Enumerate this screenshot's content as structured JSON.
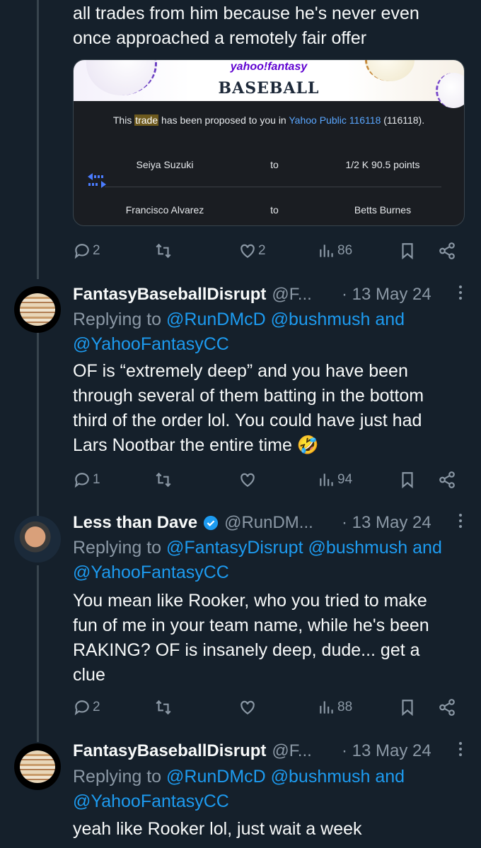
{
  "tweet0": {
    "text_tail": "all trades from him because he's never even\nonce approached a remotely fair offer",
    "attachment": {
      "brand": "yahoo!fantasy",
      "title": "BASEBALL",
      "notice_pre": "This ",
      "notice_highlight": "trade",
      "notice_mid": " has been proposed to you in ",
      "notice_link": "Yahoo Public 116118",
      "notice_post": " (116118).",
      "rows": [
        {
          "player": "Seiya Suzuki",
          "to": "to",
          "team": "1/2 K 90.5 points"
        },
        {
          "player": "Francisco Alvarez",
          "to": "to",
          "team": "Betts Burnes"
        }
      ]
    },
    "actions": {
      "replies": "2",
      "likes": "2",
      "views": "86"
    }
  },
  "tweet1": {
    "name": "FantasyBaseballDisrupt",
    "handle": "@F...",
    "date": "· 13 May 24",
    "replying_to": "Replying to",
    "mentions": "@RunDMcD @bushmush and",
    "mentions2": "@YahooFantasyCC",
    "text": "OF is “extremely deep” and you have been\nthrough several of them batting in the bottom\nthird of the order lol. You could have just had\nLars Nootbar the entire time 🤣",
    "actions": {
      "replies": "1",
      "likes": "",
      "views": "94"
    }
  },
  "tweet2": {
    "name": "Less than Dave",
    "handle": "@RunDM...",
    "date": "· 13 May 24",
    "replying_to": "Replying to",
    "mentions": "@FantasyDisrupt @bushmush and",
    "mentions2": "@YahooFantasyCC",
    "text": "You mean like Rooker, who you tried to make\nfun of me in your team name, while he's been\nRAKING? OF is insanely deep, dude... get a\nclue",
    "actions": {
      "replies": "2",
      "likes": "",
      "views": "88"
    }
  },
  "tweet3": {
    "name": "FantasyBaseballDisrupt",
    "handle": "@F...",
    "date": "· 13 May 24",
    "replying_to": "Replying to",
    "mentions": "@RunDMcD @bushmush and",
    "mentions2": "@YahooFantasyCC",
    "text": "yeah like Rooker lol, just wait a week"
  }
}
